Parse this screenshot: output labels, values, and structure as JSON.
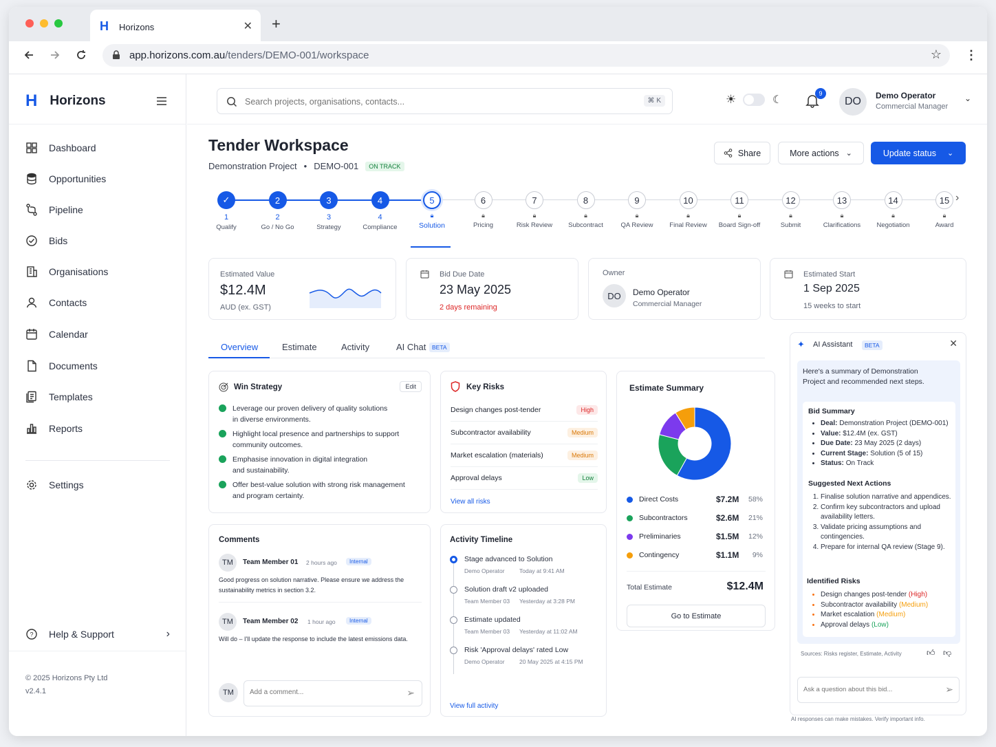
{
  "browser": {
    "tab_title": "Horizons",
    "url_host": "app.horizons.com.au",
    "url_path": "/tenders/DEMO-001/workspace"
  },
  "sidebar": {
    "brand": "Horizons",
    "items": [
      {
        "label": "Dashboard",
        "icon": "grid-icon"
      },
      {
        "label": "Opportunities",
        "icon": "database-icon"
      },
      {
        "label": "Pipeline",
        "icon": "pipeline-icon"
      },
      {
        "label": "Bids",
        "icon": "check-circle-icon"
      },
      {
        "label": "Organisations",
        "icon": "building-icon"
      },
      {
        "label": "Contacts",
        "icon": "user-icon"
      },
      {
        "label": "Calendar",
        "icon": "calendar-icon"
      },
      {
        "label": "Documents",
        "icon": "document-icon"
      },
      {
        "label": "Templates",
        "icon": "templates-icon"
      },
      {
        "label": "Reports",
        "icon": "bar-chart-icon"
      }
    ],
    "settings": "Settings",
    "help": "Help & Support",
    "copyright": "© 2025 Horizons Pty Ltd",
    "version": "v2.4.1"
  },
  "header": {
    "search_placeholder": "Search projects, organisations, contacts...",
    "shortcut": "⌘ K",
    "notif_count": "9",
    "user_initials": "DO",
    "user_name": "Demo Operator",
    "user_role": "Commercial Manager"
  },
  "page": {
    "title": "Tender Workspace",
    "project": "Demonstration Project",
    "sep": "•",
    "code": "DEMO-001",
    "status": "ON TRACK",
    "share": "Share",
    "more": "More actions",
    "update": "Update status"
  },
  "stages": [
    {
      "n": "1",
      "label": "Qualify",
      "state": "done"
    },
    {
      "n": "2",
      "label": "Go / No Go",
      "state": "done"
    },
    {
      "n": "3",
      "label": "Strategy",
      "state": "done"
    },
    {
      "n": "4",
      "label": "Compliance",
      "state": "done"
    },
    {
      "n": "5",
      "label": "Solution",
      "state": "current"
    },
    {
      "n": "6",
      "label": "Pricing",
      "state": "locked"
    },
    {
      "n": "7",
      "label": "Risk Review",
      "state": "locked"
    },
    {
      "n": "8",
      "label": "Subcontract",
      "state": "locked"
    },
    {
      "n": "9",
      "label": "QA Review",
      "state": "locked"
    },
    {
      "n": "10",
      "label": "Final Review",
      "state": "locked"
    },
    {
      "n": "11",
      "label": "Board Sign-off",
      "state": "locked"
    },
    {
      "n": "12",
      "label": "Submit",
      "state": "locked"
    },
    {
      "n": "13",
      "label": "Clarifications",
      "state": "locked"
    },
    {
      "n": "14",
      "label": "Negotiation",
      "state": "locked"
    },
    {
      "n": "15",
      "label": "Award",
      "state": "locked"
    }
  ],
  "stats": {
    "value_label": "Estimated Value",
    "value": "$12.4M",
    "value_note": "AUD (ex. GST)",
    "due_label": "Bid Due Date",
    "due": "23 May 2025",
    "due_note": "2 days remaining",
    "owner_label": "Owner",
    "owner_initials": "DO",
    "owner_name": "Demo Operator",
    "owner_role": "Commercial Manager",
    "start_label": "Estimated Start",
    "start": "1 Sep 2025",
    "start_note": "15 weeks to start"
  },
  "tabs": [
    "Overview",
    "Estimate",
    "Activity",
    "AI Chat"
  ],
  "beta": "BETA",
  "win": {
    "title": "Win Strategy",
    "edit": "Edit",
    "items": [
      [
        "Leverage our proven delivery of quality solutions",
        "in diverse environments."
      ],
      [
        "Highlight local presence and partnerships to support",
        "community outcomes."
      ],
      [
        "Emphasise innovation in digital integration",
        "and sustainability."
      ],
      [
        "Offer best-value solution with strong risk management",
        "and program certainty."
      ]
    ]
  },
  "risks": {
    "title": "Key Risks",
    "items": [
      {
        "name": "Design changes post-tender",
        "level": "High"
      },
      {
        "name": "Subcontractor availability",
        "level": "Medium"
      },
      {
        "name": "Market escalation (materials)",
        "level": "Medium"
      },
      {
        "name": "Approval delays",
        "level": "Low"
      }
    ],
    "link": "View all risks"
  },
  "estimate": {
    "title": "Estimate Summary",
    "total_label": "Total Estimate",
    "total": "$12.4M",
    "button": "Go to Estimate"
  },
  "chart_data": {
    "type": "pie",
    "categories": [
      "Direct Costs",
      "Subcontractors",
      "Preliminaries",
      "Contingency"
    ],
    "values": [
      7.2,
      2.6,
      1.5,
      1.1
    ],
    "value_labels": [
      "$7.2M",
      "$2.6M",
      "$1.5M",
      "$1.1M"
    ],
    "percent_labels": [
      "58%",
      "21%",
      "12%",
      "9%"
    ],
    "colors": [
      "#1659e6",
      "#1aa35b",
      "#7c3aed",
      "#f59e0b"
    ]
  },
  "comments": {
    "title": "Comments",
    "items": [
      {
        "initials": "TM",
        "name": "Team Member 01",
        "time": "2 hours ago",
        "tag": "Internal",
        "text1": "Good progress on solution narrative. Please ensure we address the",
        "text2": "sustainability metrics in section 3.2."
      },
      {
        "initials": "TM",
        "name": "Team Member 02",
        "time": "1 hour ago",
        "tag": "Internal",
        "text1": "Will do – I'll update the response to include the latest emissions data.",
        "text2": ""
      }
    ],
    "me": "TM",
    "placeholder": "Add a comment..."
  },
  "timeline": {
    "title": "Activity Timeline",
    "items": [
      {
        "text": "Stage advanced to Solution",
        "who": "Demo Operator",
        "when": "Today at 9:41 AM"
      },
      {
        "text": "Solution draft v2 uploaded",
        "who": "Team Member 03",
        "when": "Yesterday at 3:28 PM"
      },
      {
        "text": "Estimate updated",
        "who": "Team Member 03",
        "when": "Yesterday at 11:02 AM"
      },
      {
        "text": "Risk 'Approval delays' rated Low",
        "who": "Demo Operator",
        "when": "20 May 2025 at 4:15 PM"
      }
    ],
    "link": "View full activity"
  },
  "ai": {
    "title": "AI Assistant",
    "beta": "BETA",
    "intro": "Here's a summary of Demonstration Project and recommended next steps.",
    "summary_title": "Bid Summary",
    "summary": [
      {
        "k": "Deal:",
        "v": "Demonstration Project (DEMO-001)"
      },
      {
        "k": "Value:",
        "v": "$12.4M (ex. GST)"
      },
      {
        "k": "Due Date:",
        "v": "23 May 2025 (2 days)"
      },
      {
        "k": "Current Stage:",
        "v": "Solution (5 of 15)"
      },
      {
        "k": "Status:",
        "v": "On Track"
      }
    ],
    "actions_title": "Suggested Next Actions",
    "actions": [
      "Finalise solution narrative and appendices.",
      "Confirm key subcontractors and upload availability letters.",
      "Validate pricing assumptions and contingencies.",
      "Prepare for internal QA review (Stage 9)."
    ],
    "risks_title": "Identified Risks",
    "risks": [
      {
        "name": "Design changes post-tender",
        "level": "(High)"
      },
      {
        "name": "Subcontractor availability",
        "level": "(Medium)"
      },
      {
        "name": "Market escalation",
        "level": "(Medium)"
      },
      {
        "name": "Approval delays",
        "level": "(Low)"
      }
    ],
    "sources": "Sources: Risks register, Estimate, Activity",
    "placeholder": "Ask a question about this bid...",
    "disclaimer": "AI responses can make mistakes. Verify important info."
  }
}
